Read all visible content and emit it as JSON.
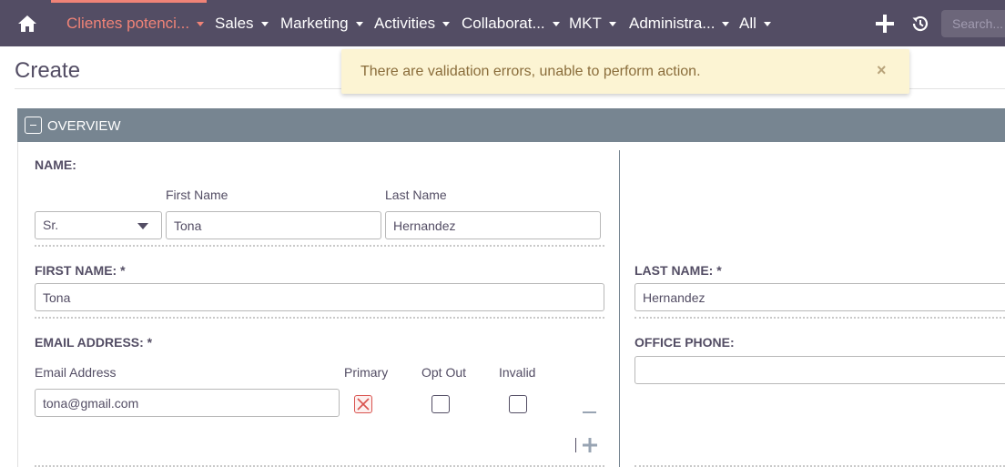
{
  "nav": {
    "items": [
      {
        "label": "Clientes potenci...",
        "active": true
      },
      {
        "label": "Sales"
      },
      {
        "label": "Marketing"
      },
      {
        "label": "Activities"
      },
      {
        "label": "Collaborat..."
      },
      {
        "label": "MKT"
      },
      {
        "label": "Administra..."
      },
      {
        "label": "All"
      }
    ],
    "search_placeholder": "Search...",
    "icons": [
      "home-icon",
      "plus-icon",
      "history-icon"
    ]
  },
  "page": {
    "title": "Create"
  },
  "alert": {
    "message": "There are validation errors, unable to perform action.",
    "close": "×"
  },
  "panel": {
    "title": "OVERVIEW",
    "name": {
      "label": "NAME:",
      "first_name_caption": "First Name",
      "last_name_caption": "Last Name",
      "salutation": "Sr.",
      "first_name": "Tona",
      "last_name": "Hernandez"
    },
    "first_name_field": {
      "label": "FIRST NAME: *",
      "value": "Tona"
    },
    "last_name_field": {
      "label": "LAST NAME: *",
      "value": "Hernandez"
    },
    "email": {
      "label": "EMAIL ADDRESS: *",
      "col_address": "Email Address",
      "col_primary": "Primary",
      "col_opt_out": "Opt Out",
      "col_invalid": "Invalid",
      "value": "tona@gmail.com"
    },
    "office_phone": {
      "label": "OFFICE PHONE:",
      "value": ""
    }
  },
  "colors": {
    "nav_bg": "#534d64",
    "accent": "#f08377",
    "panel_header": "#778591",
    "alert_bg": "#fcf4d3"
  }
}
